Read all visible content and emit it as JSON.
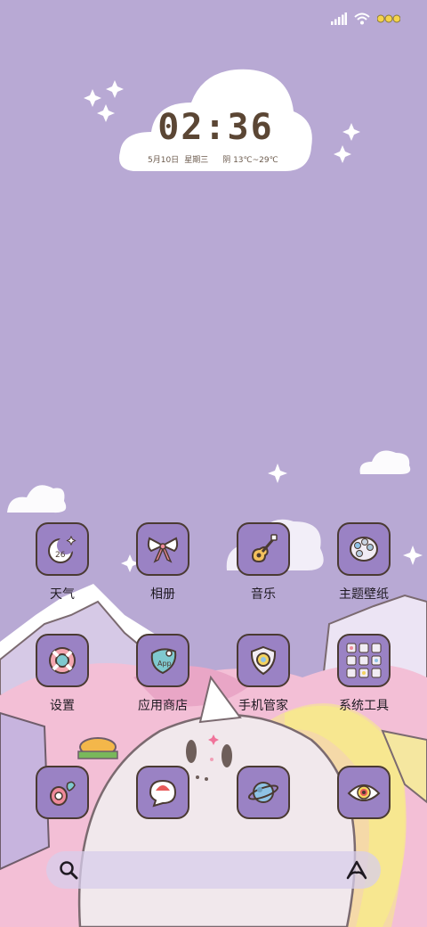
{
  "status_bar": {
    "signal_icon": "signal-icon",
    "wifi_icon": "wifi-icon",
    "battery_icon": "battery-icon"
  },
  "clock_widget": {
    "time": "02:36",
    "date": "5月10日",
    "weekday": "星期三",
    "weather": "阴 13℃~29℃"
  },
  "apps_row1": [
    {
      "label": "天气",
      "icon": "weather-moon-icon"
    },
    {
      "label": "相册",
      "icon": "gallery-bow-icon"
    },
    {
      "label": "音乐",
      "icon": "music-guitar-icon"
    },
    {
      "label": "主题壁纸",
      "icon": "theme-palette-icon"
    }
  ],
  "apps_row2": [
    {
      "label": "设置",
      "icon": "settings-lifebuoy-icon"
    },
    {
      "label": "应用商店",
      "icon": "app-store-bag-icon"
    },
    {
      "label": "手机管家",
      "icon": "phone-manager-shield-icon"
    },
    {
      "label": "系统工具",
      "icon": "system-tools-folder-icon"
    }
  ],
  "dock": [
    {
      "icon": "phone-icon"
    },
    {
      "icon": "messages-icon"
    },
    {
      "icon": "browser-planet-icon"
    },
    {
      "icon": "camera-eye-icon"
    }
  ],
  "search_bar": {
    "search_icon": "search-icon",
    "assistant_icon": "assistant-icon"
  },
  "colors": {
    "background": "#b8a9d4",
    "tile": "#9a82c4",
    "tile_border": "#4a3a32",
    "clock_text": "#5b4634"
  }
}
